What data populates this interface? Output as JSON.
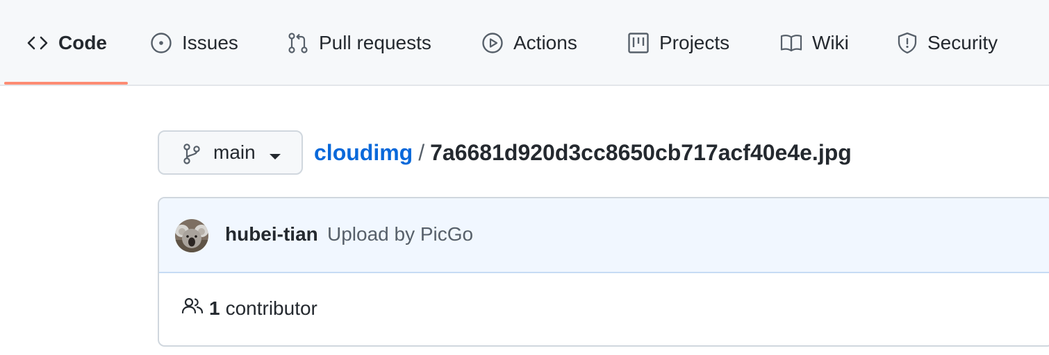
{
  "repo_nav": {
    "tabs": [
      {
        "label": "Code",
        "icon": "code-icon",
        "active": true
      },
      {
        "label": "Issues",
        "icon": "issue-opened-icon"
      },
      {
        "label": "Pull requests",
        "icon": "git-pull-request-icon"
      },
      {
        "label": "Actions",
        "icon": "play-icon"
      },
      {
        "label": "Projects",
        "icon": "project-icon"
      },
      {
        "label": "Wiki",
        "icon": "book-icon"
      },
      {
        "label": "Security",
        "icon": "shield-icon"
      }
    ],
    "active_color": "#fd8c73"
  },
  "branch": {
    "name": "main",
    "icon": "git-branch-icon"
  },
  "breadcrumb": {
    "repo": "cloudimg",
    "separator": "/",
    "file": "7a6681d920d3cc8650cb717acf40e4e.jpg"
  },
  "commit": {
    "author": "hubei-tian",
    "message": "Upload by PicGo",
    "avatar": "koala-avatar"
  },
  "contributors": {
    "count": "1",
    "label": "contributor",
    "icon": "people-icon"
  },
  "colors": {
    "link": "#0969da",
    "text": "#24292f",
    "muted": "#57606a",
    "header_bg": "#f1f7ff"
  }
}
